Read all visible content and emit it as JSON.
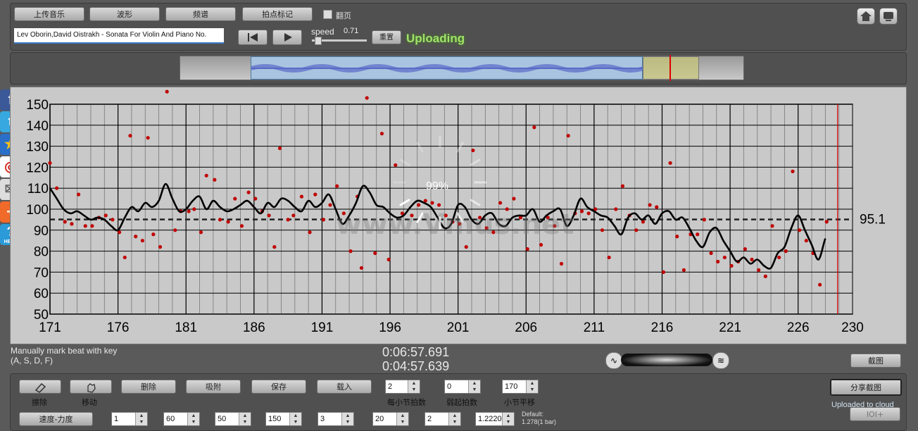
{
  "toolbar": {
    "upload_music": "上传音乐",
    "waveform": "波形",
    "spectrum": "频谱",
    "tap_mark": "拍点标记",
    "page_turn": "翻页",
    "track_title": "Lev Oborin,David Oistrakh - Sonata For Violin And Piano No.",
    "speed_label": "speed",
    "speed_value": "0.71",
    "reset": "重置",
    "status": "Uploading"
  },
  "chart_data": {
    "type": "line",
    "ylim": [
      50,
      150
    ],
    "xlim": [
      171,
      230
    ],
    "y_ticks": [
      "50",
      "60",
      "70",
      "80",
      "90",
      "100",
      "110",
      "120",
      "130",
      "140",
      "150"
    ],
    "x_ticks": [
      "171",
      "176",
      "181",
      "186",
      "191",
      "196",
      "201",
      "206",
      "211",
      "216",
      "221",
      "226",
      "230"
    ],
    "average_value": "95.1",
    "average": 95.1,
    "progress_text": "99%",
    "watermark": "www.Vmus.net",
    "cursor_x": 228.9,
    "smooth_x": [
      171,
      171.5,
      172,
      172.5,
      173,
      173.5,
      174,
      174.5,
      175,
      175.5,
      176,
      176.5,
      177,
      177.5,
      178,
      178.5,
      179,
      179.5,
      180,
      180.5,
      181,
      181.5,
      182,
      182.5,
      183,
      183.5,
      184,
      184.5,
      185,
      185.5,
      186,
      186.5,
      187,
      187.5,
      188,
      188.5,
      189,
      189.5,
      190,
      190.5,
      191,
      191.5,
      192,
      192.5,
      193,
      193.5,
      194,
      194.5,
      195,
      195.5,
      196,
      196.5,
      197,
      197.5,
      198,
      198.5,
      199,
      199.5,
      200,
      200.5,
      201,
      201.5,
      202,
      202.5,
      203,
      203.5,
      204,
      204.5,
      205,
      205.5,
      206,
      206.5,
      207,
      207.5,
      208,
      208.5,
      209,
      209.5,
      210,
      210.5,
      211,
      211.5,
      212,
      212.5,
      213,
      213.5,
      214,
      214.5,
      215,
      215.5,
      216,
      216.5,
      217,
      217.5,
      218,
      218.5,
      219,
      219.5,
      220,
      220.5,
      221,
      221.5,
      222,
      222.5,
      223,
      223.5,
      224,
      224.5,
      225,
      225.5,
      226,
      226.5,
      227,
      227.5,
      228,
      228.5,
      229
    ],
    "smooth_y": [
      110,
      105,
      100,
      98,
      99,
      97,
      95,
      96,
      95,
      92,
      90,
      96,
      101,
      99,
      103,
      101,
      104,
      112,
      105,
      99,
      100,
      104,
      106,
      100,
      104,
      101,
      99,
      100,
      102,
      104,
      101,
      98,
      103,
      101,
      105,
      104,
      101,
      99,
      104,
      101,
      103,
      107,
      100,
      93,
      97,
      103,
      111,
      108,
      102,
      101,
      98,
      96,
      97,
      101,
      104,
      103,
      101,
      96,
      91,
      93,
      102,
      101,
      95,
      93,
      97,
      98,
      93,
      92,
      96,
      97,
      97,
      100,
      94,
      97,
      99,
      100,
      92,
      97,
      105,
      101,
      99,
      97,
      96,
      92,
      88,
      96,
      98,
      95,
      97,
      93,
      98,
      99,
      95,
      96,
      91,
      85,
      82,
      89,
      91,
      85,
      80,
      75,
      77,
      74,
      76,
      73,
      72,
      79,
      82,
      91,
      97,
      90,
      83,
      76,
      86,
      93
    ],
    "scatter": [
      [
        171,
        122
      ],
      [
        171.5,
        110
      ],
      [
        172.1,
        94
      ],
      [
        172.6,
        93
      ],
      [
        173.1,
        107
      ],
      [
        173.6,
        92
      ],
      [
        174.1,
        92
      ],
      [
        174.6,
        96
      ],
      [
        175.1,
        97
      ],
      [
        175.6,
        95
      ],
      [
        176.1,
        89
      ],
      [
        176.5,
        77
      ],
      [
        176.9,
        135
      ],
      [
        177.3,
        87
      ],
      [
        177.8,
        85
      ],
      [
        178.2,
        134
      ],
      [
        178.6,
        88
      ],
      [
        179.1,
        82
      ],
      [
        179.6,
        156
      ],
      [
        180.2,
        90
      ],
      [
        180.6,
        99
      ],
      [
        181.2,
        99
      ],
      [
        181.6,
        100
      ],
      [
        182.1,
        89
      ],
      [
        182.5,
        116
      ],
      [
        183.1,
        114
      ],
      [
        183.5,
        95
      ],
      [
        184.1,
        94
      ],
      [
        184.6,
        105
      ],
      [
        185.1,
        92
      ],
      [
        185.6,
        108
      ],
      [
        186.1,
        105
      ],
      [
        186.6,
        99
      ],
      [
        187.1,
        97
      ],
      [
        187.5,
        82
      ],
      [
        187.9,
        129
      ],
      [
        188.5,
        95
      ],
      [
        188.9,
        97
      ],
      [
        189.5,
        106
      ],
      [
        190.1,
        89
      ],
      [
        190.5,
        107
      ],
      [
        191.1,
        95
      ],
      [
        191.6,
        102
      ],
      [
        192.1,
        111
      ],
      [
        192.6,
        98
      ],
      [
        193.1,
        80
      ],
      [
        193.6,
        106
      ],
      [
        193.9,
        72
      ],
      [
        194.3,
        153
      ],
      [
        194.9,
        79
      ],
      [
        195.4,
        136
      ],
      [
        195.9,
        76
      ],
      [
        196.4,
        121
      ],
      [
        196.9,
        98
      ],
      [
        197.6,
        97
      ],
      [
        198.1,
        102
      ],
      [
        198.6,
        104
      ],
      [
        199.1,
        103
      ],
      [
        199.6,
        102
      ],
      [
        200.1,
        97
      ],
      [
        200.6,
        94
      ],
      [
        201.1,
        93
      ],
      [
        201.6,
        82
      ],
      [
        202.1,
        128
      ],
      [
        202.6,
        96
      ],
      [
        203.1,
        91
      ],
      [
        203.6,
        89
      ],
      [
        204.1,
        103
      ],
      [
        204.6,
        100
      ],
      [
        205.1,
        105
      ],
      [
        205.6,
        96
      ],
      [
        206.1,
        81
      ],
      [
        206.6,
        139
      ],
      [
        207.1,
        83
      ],
      [
        207.6,
        96
      ],
      [
        208.1,
        92
      ],
      [
        208.6,
        74
      ],
      [
        209.1,
        135
      ],
      [
        209.6,
        98
      ],
      [
        210.1,
        99
      ],
      [
        210.6,
        98
      ],
      [
        211.1,
        100
      ],
      [
        211.6,
        90
      ],
      [
        212.1,
        77
      ],
      [
        212.6,
        100
      ],
      [
        213.1,
        111
      ],
      [
        213.6,
        97
      ],
      [
        214.1,
        90
      ],
      [
        214.6,
        94
      ],
      [
        215.1,
        102
      ],
      [
        215.6,
        101
      ],
      [
        216.1,
        70
      ],
      [
        216.6,
        122
      ],
      [
        217.1,
        87
      ],
      [
        217.6,
        71
      ],
      [
        218.1,
        88
      ],
      [
        218.6,
        88
      ],
      [
        219.1,
        95
      ],
      [
        219.6,
        79
      ],
      [
        220.1,
        75
      ],
      [
        220.6,
        77
      ],
      [
        221.1,
        73
      ],
      [
        221.6,
        75
      ],
      [
        222.1,
        81
      ],
      [
        222.6,
        76
      ],
      [
        223.1,
        71
      ],
      [
        223.6,
        68
      ],
      [
        224.1,
        92
      ],
      [
        224.6,
        77
      ],
      [
        225.1,
        80
      ],
      [
        225.6,
        118
      ],
      [
        226.1,
        90
      ],
      [
        226.6,
        85
      ],
      [
        227.1,
        79
      ],
      [
        227.6,
        64
      ],
      [
        228.1,
        94
      ]
    ]
  },
  "status": {
    "hint_line1": "Manually mark beat with key",
    "hint_line2": "(A, S, D, F)",
    "time1": "0:06:57.691",
    "time2": "0:04:57.639",
    "screenshot": "截图"
  },
  "bottom": {
    "erase": "擦除",
    "move": "移动",
    "delete": "删除",
    "snap": "吸附",
    "save": "保存",
    "load": "载入",
    "beats_per_bar_value": "2",
    "beats_per_bar_label": "每小节拍数",
    "pickup_value": "0",
    "pickup_label": "弱起拍数",
    "bar_shift_value": "170",
    "bar_shift_label": "小节平移",
    "share": "分享截图",
    "uploaded": "Uploaded to cloud",
    "id_button": "IOI+",
    "speed_force": "速度-力度",
    "s1": "1",
    "s2": "60",
    "s3": "50",
    "s4": "150",
    "s5": "3",
    "s6": "20",
    "s7": "2",
    "s8": "1.2220",
    "default_line1": "Default:",
    "default_line2": "1.278(1 bar)"
  },
  "social": {
    "help": "HELP"
  }
}
